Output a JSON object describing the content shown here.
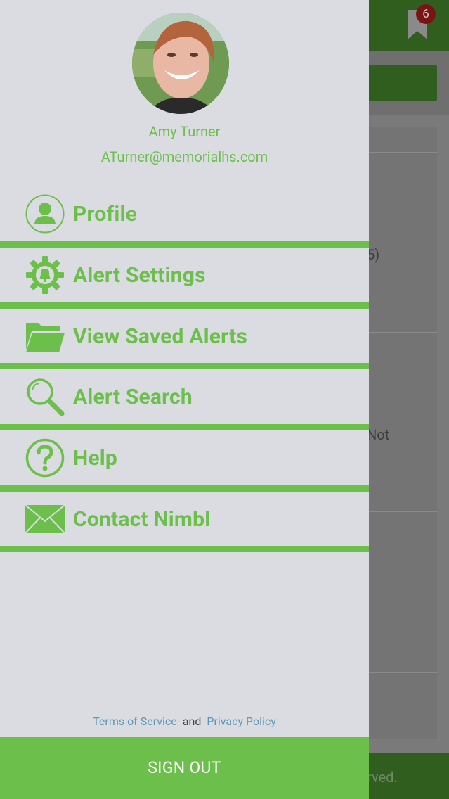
{
  "background": {
    "badge_count": "6",
    "snippet_1": "5)",
    "snippet_2": "Not",
    "footer_text": "rved."
  },
  "user": {
    "name": "Amy Turner",
    "email": "ATurner@memorialhs.com"
  },
  "menu": [
    {
      "label": "Profile",
      "icon": "person-icon"
    },
    {
      "label": "Alert Settings",
      "icon": "gear-bell-icon"
    },
    {
      "label": "View Saved Alerts",
      "icon": "folder-icon"
    },
    {
      "label": "Alert Search",
      "icon": "search-icon"
    },
    {
      "label": "Help",
      "icon": "help-icon"
    },
    {
      "label": "Contact Nimbl",
      "icon": "mail-icon"
    }
  ],
  "footer": {
    "terms": "Terms of Service",
    "and": "and",
    "privacy": "Privacy Policy"
  },
  "signout_label": "SIGN OUT",
  "colors": {
    "accent": "#6bbf4a",
    "drawer_bg": "#dbdce2",
    "link": "#5b98b8"
  }
}
